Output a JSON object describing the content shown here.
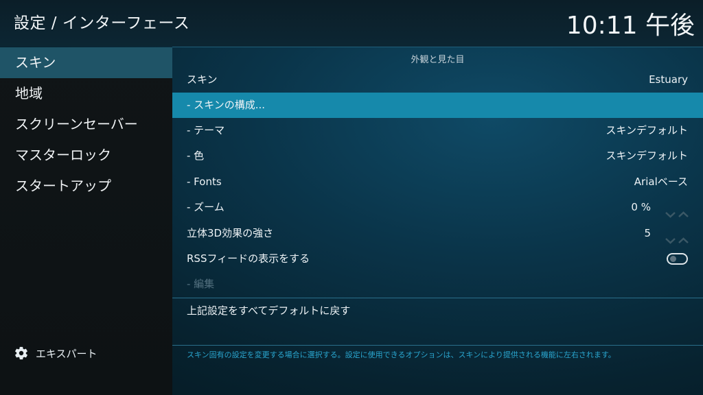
{
  "header": {
    "breadcrumb": "設定 / インターフェース",
    "clock": "10:11 午後"
  },
  "sidebar": {
    "items": [
      {
        "label": "スキン",
        "active": true
      },
      {
        "label": "地域"
      },
      {
        "label": "スクリーンセーバー"
      },
      {
        "label": "マスターロック"
      },
      {
        "label": "スタートアップ"
      }
    ],
    "expert_label": "エキスパート",
    "expert_icon": "gear-icon"
  },
  "main": {
    "section_title": "外観と見た目",
    "rows": [
      {
        "label": "スキン",
        "value": "Estuary"
      },
      {
        "label": "- スキンの構成...",
        "value": ""
      },
      {
        "label": "- テーマ",
        "value": "スキンデフォルト"
      },
      {
        "label": "- 色",
        "value": "スキンデフォルト"
      },
      {
        "label": "- Fonts",
        "value": "Arialベース"
      },
      {
        "label": "- ズーム",
        "value": "0 %"
      },
      {
        "label": "立体3D効果の強さ",
        "value": "5"
      },
      {
        "label": "RSSフィードの表示をする",
        "toggle": false
      },
      {
        "label": "- 編集",
        "disabled": true
      }
    ],
    "reset_label": "上記設定をすべてデフォルトに戻す",
    "help_text": "スキン固有の設定を変更する場合に選択する。設定に使用できるオプションは、スキンにより提供される機能に左右されます。"
  },
  "colors": {
    "focus": "#1689ab",
    "sidebar_active": "#1f5467",
    "help_text": "#2aa6cf"
  }
}
